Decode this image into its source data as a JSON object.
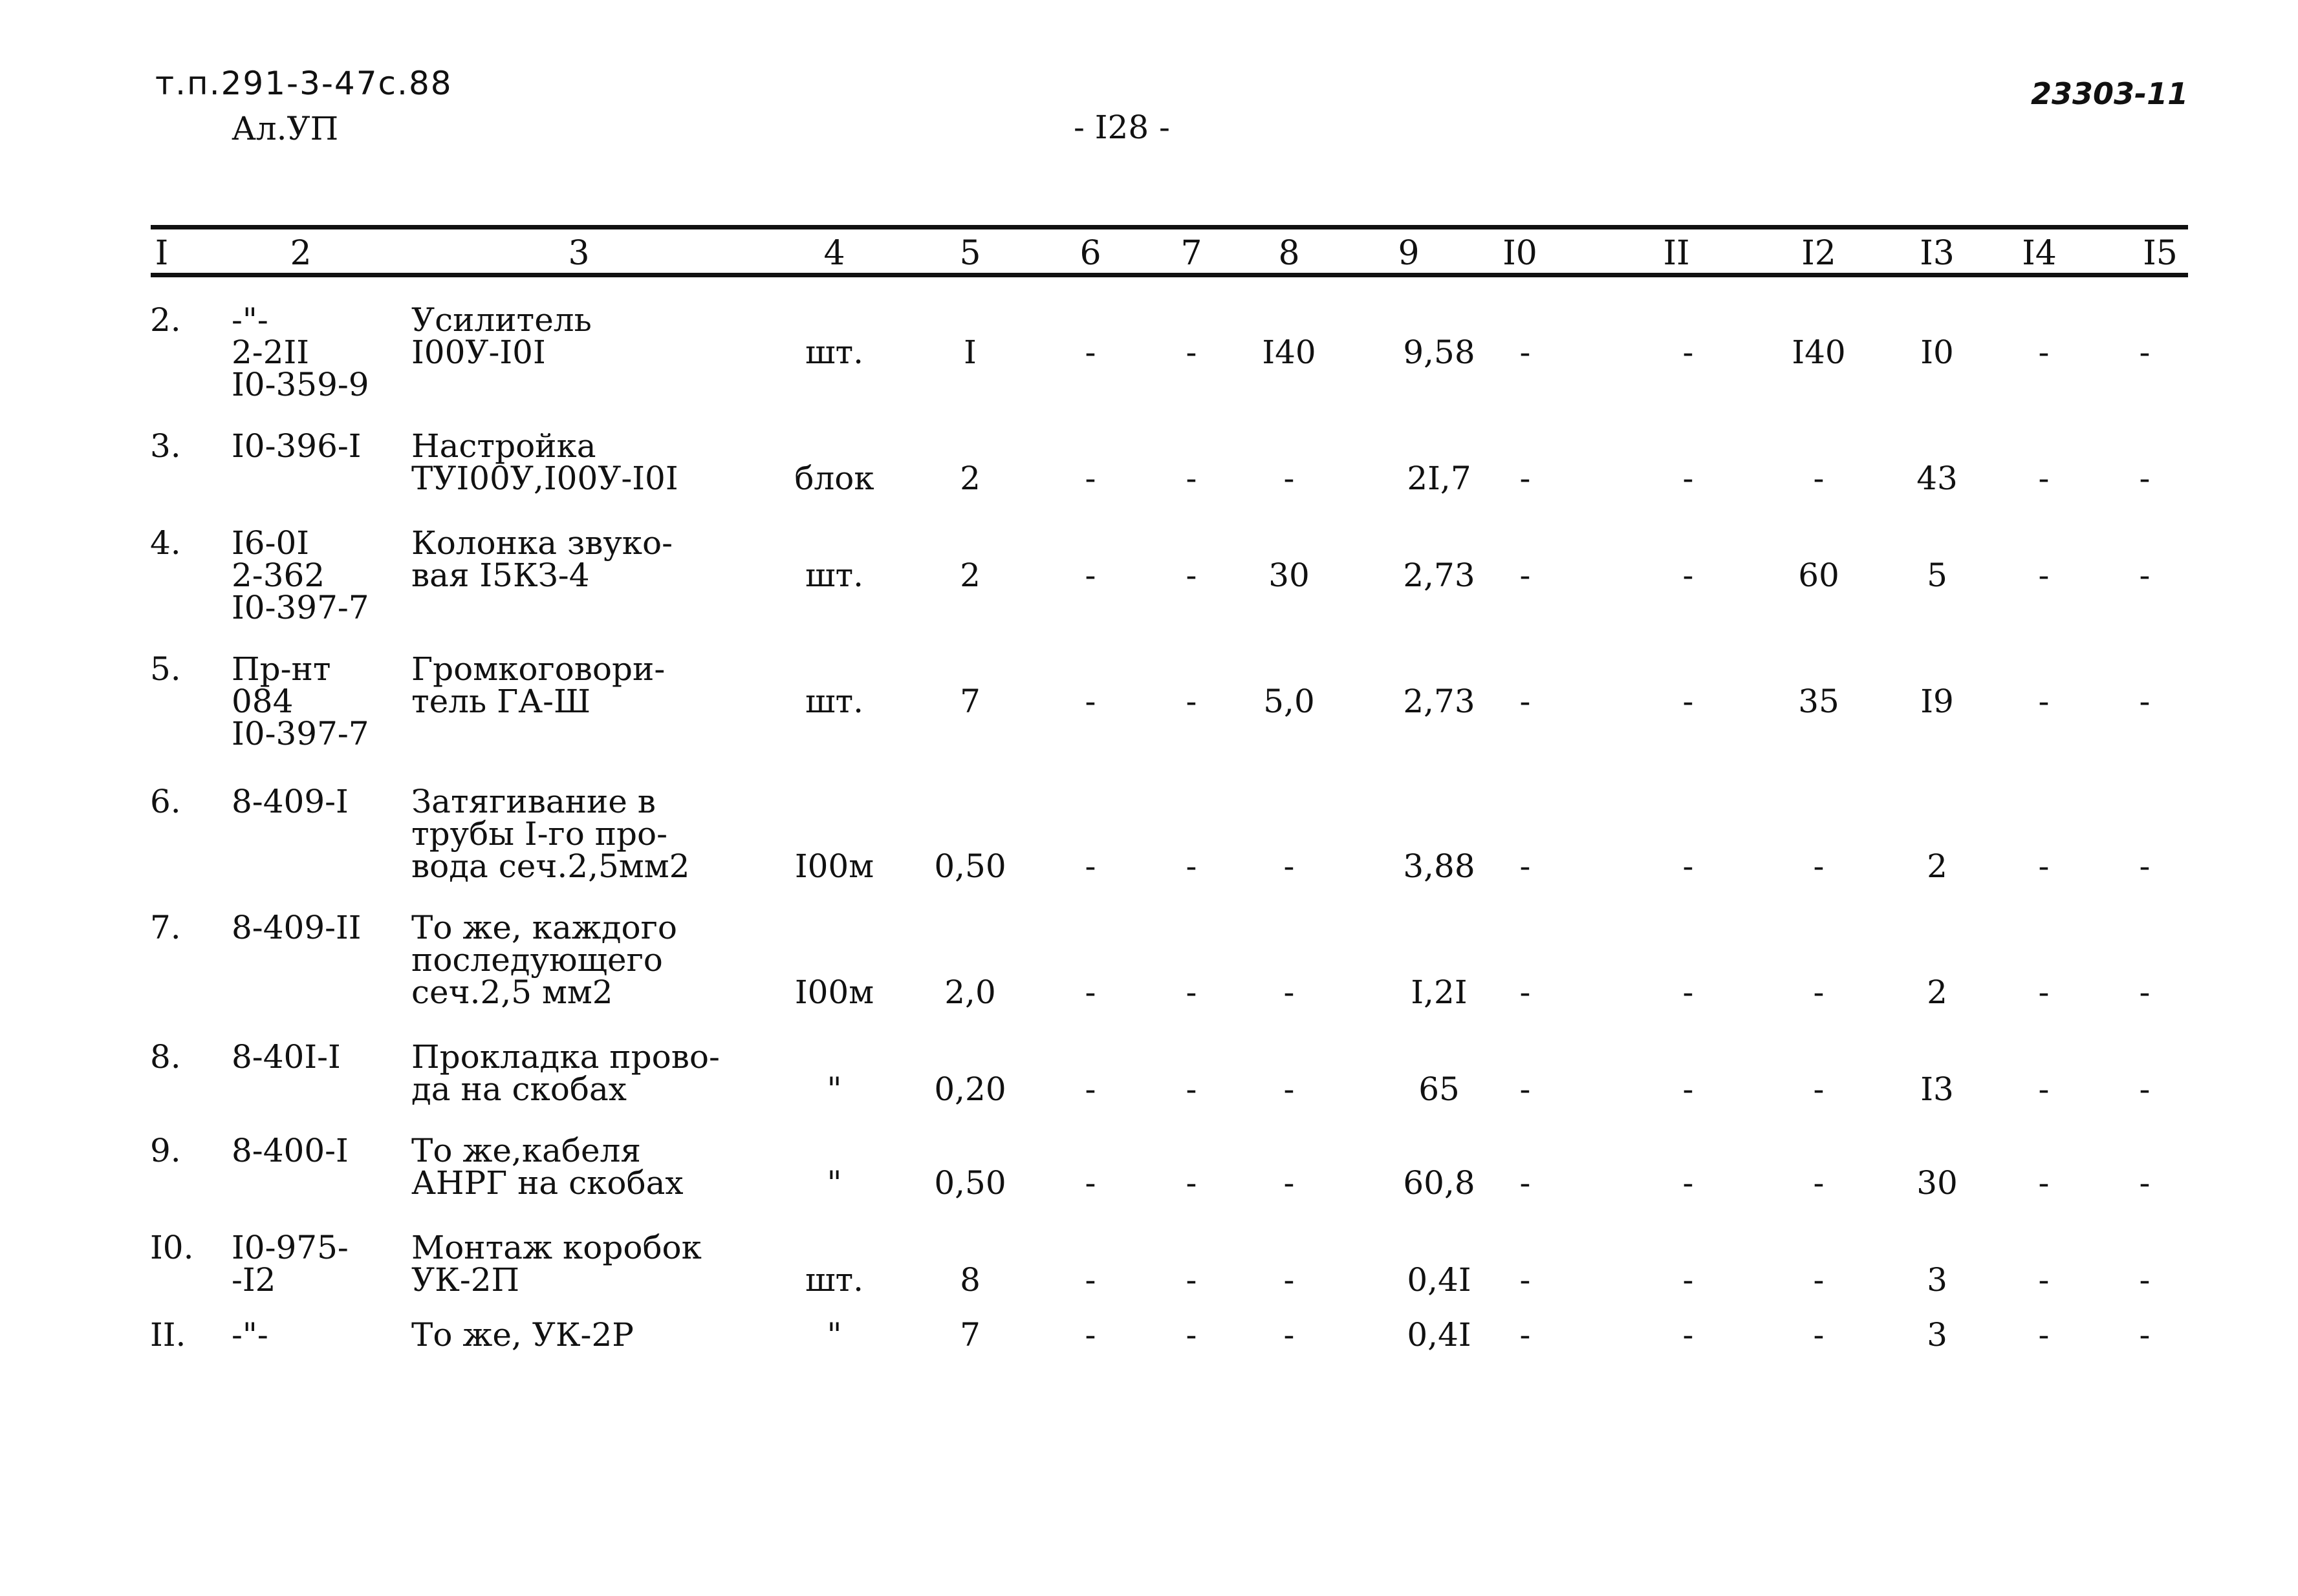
{
  "header": {
    "doc_code": "т.п.291-3-47с.88",
    "album": "Ал.УП",
    "page_number": "- I28 -",
    "stamp": "23303-11"
  },
  "table": {
    "column_headers": [
      "I",
      "2",
      "3",
      "4",
      "5",
      "6",
      "7",
      "8",
      "9",
      "I0",
      "II",
      "I2",
      "I3",
      "I4",
      "I5"
    ],
    "rows": [
      {
        "num": "2.",
        "code": [
          "-\"-",
          "2-2II",
          "I0-359-9"
        ],
        "name": [
          "Усилитель",
          "I00У-I0I"
        ],
        "unit": "шт.",
        "c5": "I",
        "c6": "-",
        "c7": "-",
        "c8": "I40",
        "c9": "9,58",
        "c10": "-",
        "c11": "-",
        "c12": "I40",
        "c13": "I0",
        "c14": "-",
        "c15": "-"
      },
      {
        "num": "3.",
        "code": [
          "I0-396-I"
        ],
        "name": [
          "Настройка",
          "ТУI00У,I00У-I0I"
        ],
        "unit": "блок",
        "c5": "2",
        "c6": "-",
        "c7": "-",
        "c8": "-",
        "c9": "2I,7",
        "c10": "-",
        "c11": "-",
        "c12": "-",
        "c13": "43",
        "c14": "-",
        "c15": "-"
      },
      {
        "num": "4.",
        "code": [
          "I6-0I",
          "2-362",
          "I0-397-7"
        ],
        "name": [
          "Колонка звуко-",
          "вая I5КЗ-4"
        ],
        "unit": "шт.",
        "c5": "2",
        "c6": "-",
        "c7": "-",
        "c8": "30",
        "c9": "2,73",
        "c10": "-",
        "c11": "-",
        "c12": "60",
        "c13": "5",
        "c14": "-",
        "c15": "-"
      },
      {
        "num": "5.",
        "code": [
          "Пр-нт",
          "084",
          "I0-397-7"
        ],
        "name": [
          "Громкоговори-",
          "тель ГА-Ш"
        ],
        "unit": "шт.",
        "c5": "7",
        "c6": "-",
        "c7": "-",
        "c8": "5,0",
        "c9": "2,73",
        "c10": "-",
        "c11": "-",
        "c12": "35",
        "c13": "I9",
        "c14": "-",
        "c15": "-"
      },
      {
        "num": "6.",
        "code": [
          "8-409-I"
        ],
        "name": [
          "Затягивание в",
          "трубы I-го про-",
          "вода сеч.2,5мм2"
        ],
        "unit": "I00м",
        "c5": "0,50",
        "c6": "-",
        "c7": "-",
        "c8": "-",
        "c9": "3,88",
        "c10": "-",
        "c11": "-",
        "c12": "-",
        "c13": "2",
        "c14": "-",
        "c15": "-"
      },
      {
        "num": "7.",
        "code": [
          "8-409-II"
        ],
        "name": [
          "То же, каждого",
          "последующего",
          "сеч.2,5 мм2"
        ],
        "unit": "I00м",
        "c5": "2,0",
        "c6": "-",
        "c7": "-",
        "c8": "-",
        "c9": "I,2I",
        "c10": "-",
        "c11": "-",
        "c12": "-",
        "c13": "2",
        "c14": "-",
        "c15": "-"
      },
      {
        "num": "8.",
        "code": [
          "8-40I-I"
        ],
        "name": [
          "Прокладка прово-",
          "да на скобах"
        ],
        "unit": "\"",
        "c5": "0,20",
        "c6": "-",
        "c7": "-",
        "c8": "-",
        "c9": "65",
        "c10": "-",
        "c11": "-",
        "c12": "-",
        "c13": "I3",
        "c14": "-",
        "c15": "-"
      },
      {
        "num": "9.",
        "code": [
          "8-400-I"
        ],
        "name": [
          "То же,кабеля",
          "АНРГ на скобах"
        ],
        "unit": "\"",
        "c5": "0,50",
        "c6": "-",
        "c7": "-",
        "c8": "-",
        "c9": "60,8",
        "c10": "-",
        "c11": "-",
        "c12": "-",
        "c13": "30",
        "c14": "-",
        "c15": "-"
      },
      {
        "num": "I0.",
        "code": [
          "I0-975-",
          "-I2"
        ],
        "name": [
          "Монтаж коробок",
          "УК-2П"
        ],
        "unit": "шт.",
        "c5": "8",
        "c6": "-",
        "c7": "-",
        "c8": "-",
        "c9": "0,4I",
        "c10": "-",
        "c11": "-",
        "c12": "-",
        "c13": "3",
        "c14": "-",
        "c15": "-"
      },
      {
        "num": "II.",
        "code": [
          "-\"-"
        ],
        "name": [
          "То же, УК-2Р"
        ],
        "unit": "\"",
        "c5": "7",
        "c6": "-",
        "c7": "-",
        "c8": "-",
        "c9": "0,4I",
        "c10": "-",
        "c11": "-",
        "c12": "-",
        "c13": "3",
        "c14": "-",
        "c15": "-"
      }
    ]
  }
}
